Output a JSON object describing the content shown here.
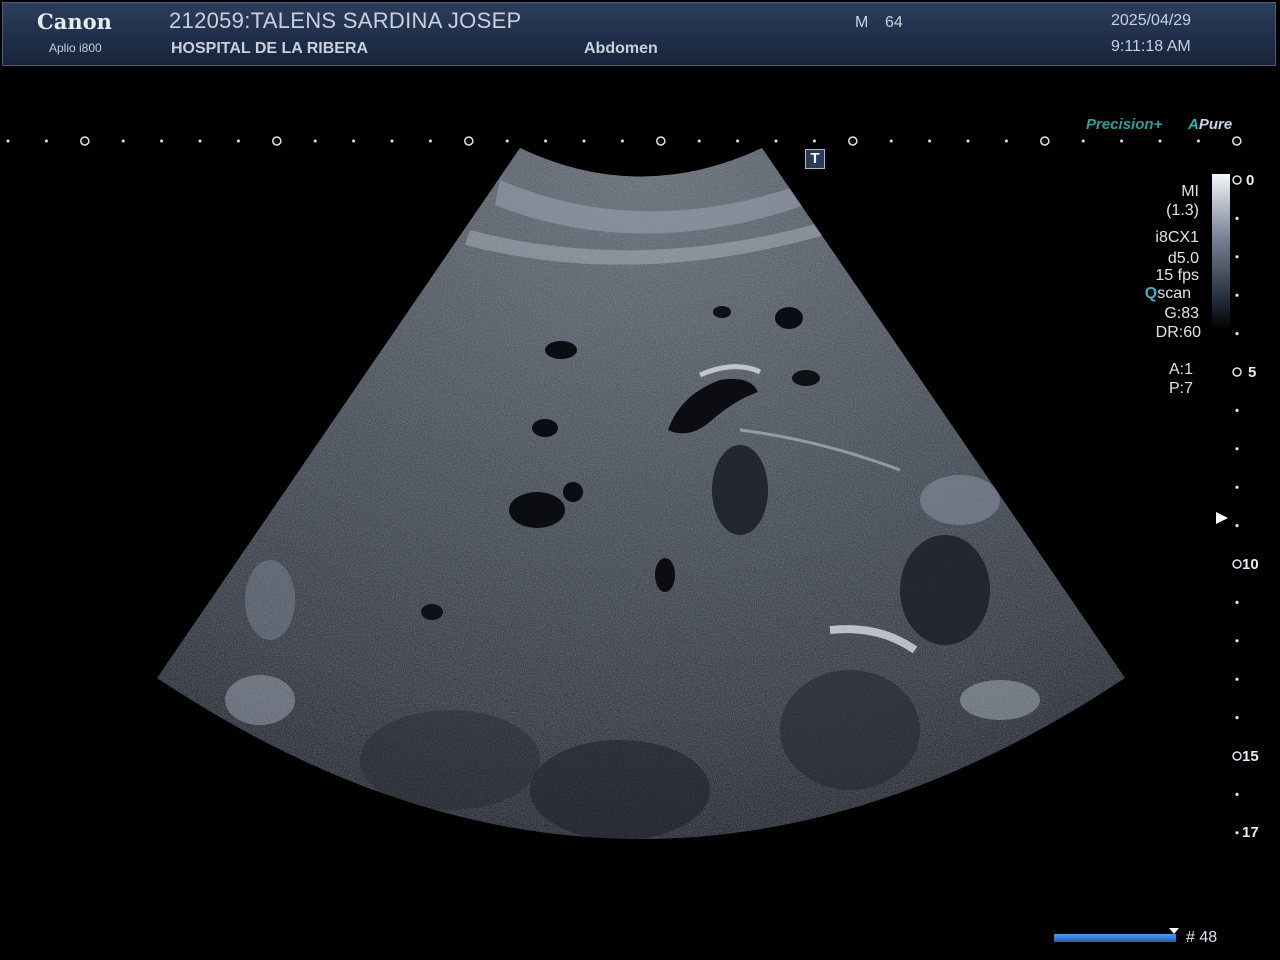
{
  "header": {
    "brand": "Canon",
    "model": "Aplio i800",
    "patient": "212059:TALENS SARDINA JOSEP",
    "hospital": "HOSPITAL DE LA RIBERA",
    "sex": "M",
    "age": "64",
    "exam": "Abdomen",
    "date": "2025/04/29",
    "time": "9:11:18 AM"
  },
  "modes": {
    "precision": "Precision+",
    "apure_a": "A",
    "apure_rest": "Pure",
    "tmark": "T"
  },
  "params": {
    "mi_label": "MI",
    "mi_value": "(1.3)",
    "probe": "i8CX1",
    "depth": "d5.0",
    "fps": "15 fps",
    "qscan_q": "Q",
    "qscan_rest": "scan",
    "gain": "G:83",
    "dr": "DR:60",
    "a": "A:1",
    "p": "P:7"
  },
  "depth_scale": {
    "labels": [
      "0",
      "5",
      "10",
      "15",
      "17"
    ],
    "focus_depth_cm": 8.8
  },
  "cine": {
    "frame": "# 48",
    "progress": 1.0
  },
  "colors": {
    "header_bg": "#1f2f4a",
    "accent_teal": "#2d9e9e",
    "cine_blue": "#2a78d8"
  }
}
